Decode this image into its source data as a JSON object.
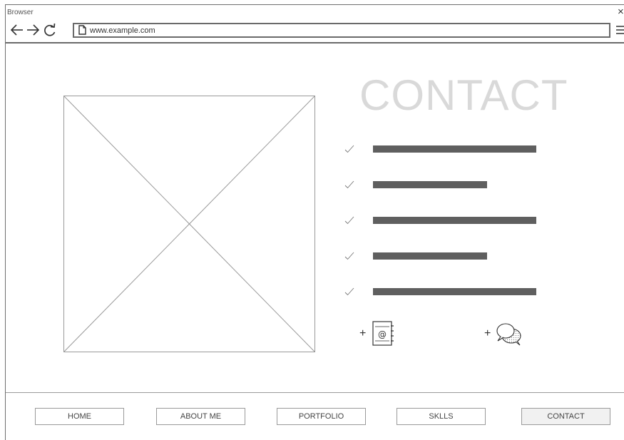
{
  "window": {
    "title": "Browser",
    "close_label": "×"
  },
  "address_bar": {
    "url": "www.example.com"
  },
  "icons": {
    "back": "back-arrow-icon",
    "forward": "forward-arrow-icon",
    "reload": "reload-icon",
    "page": "page-icon",
    "menu": "hamburger-menu-icon",
    "check": "checkmark-icon",
    "address_book": "address-book-icon",
    "chat": "chat-bubbles-icon"
  },
  "main": {
    "heading": "CONTACT",
    "contact_items": [
      {
        "length": 1.0
      },
      {
        "length": 0.7
      },
      {
        "length": 1.0
      },
      {
        "length": 0.7
      },
      {
        "length": 1.0
      }
    ],
    "actions": {
      "add_email_label": "+",
      "add_chat_label": "+"
    }
  },
  "footer": {
    "nav": [
      {
        "label": "HOME",
        "active": false
      },
      {
        "label": "ABOUT ME",
        "active": false
      },
      {
        "label": "PORTFOLIO",
        "active": false
      },
      {
        "label": "SKLLS",
        "active": false
      },
      {
        "label": "CONTACT",
        "active": true
      }
    ]
  },
  "colors": {
    "heading": "#d9d9d9",
    "placeholder_line": "#5f5f5f",
    "border": "#6a6a6a",
    "active_tab_bg": "#f1f1f1"
  }
}
